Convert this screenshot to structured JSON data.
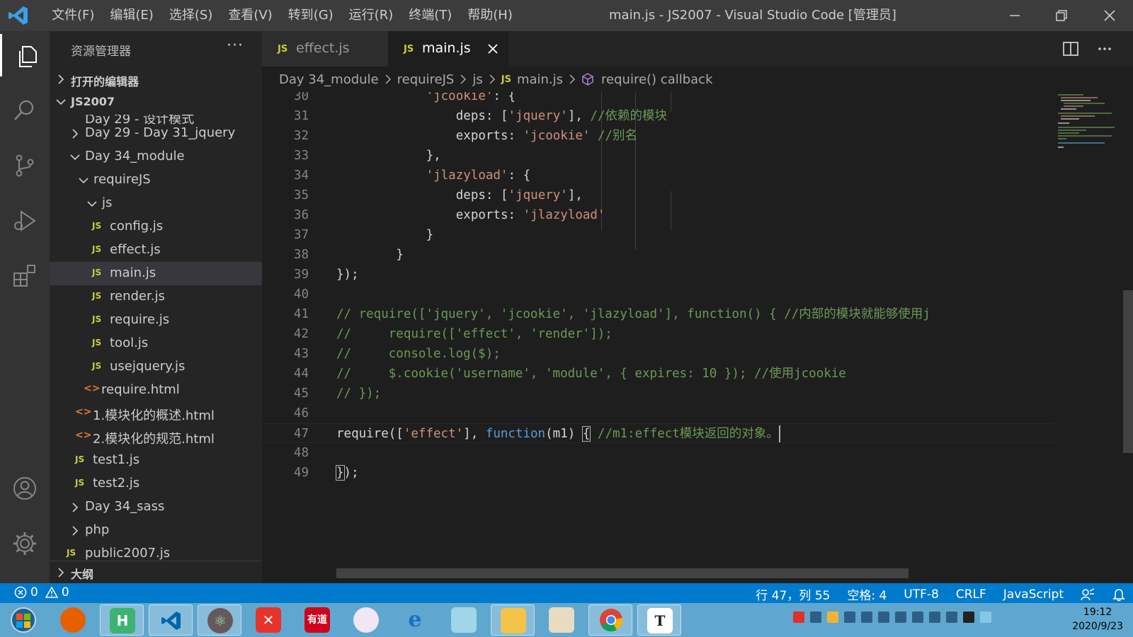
{
  "titlebar": {
    "menus": [
      "文件(F)",
      "编辑(E)",
      "选择(S)",
      "查看(V)",
      "转到(G)",
      "运行(R)",
      "终端(T)",
      "帮助(H)"
    ],
    "title": "main.js - JS2007 - Visual Studio Code [管理员]"
  },
  "sidebar": {
    "title": "资源管理器",
    "more": "···",
    "open_editors": "打开的编辑器",
    "root": "JS2007",
    "cut_item": "Day 29 - 设计模式",
    "items": [
      {
        "label": "Day 29 - Day 31_jquery",
        "kind": "folder",
        "expanded": false
      },
      {
        "label": "Day 34_module",
        "kind": "folder",
        "expanded": true
      },
      {
        "label": "requireJS",
        "kind": "folder",
        "expanded": true
      },
      {
        "label": "js",
        "kind": "folder",
        "expanded": true
      },
      {
        "label": "config.js",
        "kind": "js"
      },
      {
        "label": "effect.js",
        "kind": "js"
      },
      {
        "label": "main.js",
        "kind": "js",
        "selected": true
      },
      {
        "label": "render.js",
        "kind": "js"
      },
      {
        "label": "require.js",
        "kind": "js"
      },
      {
        "label": "tool.js",
        "kind": "js"
      },
      {
        "label": "usejquery.js",
        "kind": "js"
      },
      {
        "label": "require.html",
        "kind": "html"
      },
      {
        "label": "1.模块化的概述.html",
        "kind": "html"
      },
      {
        "label": "2.模块化的规范.html",
        "kind": "html"
      },
      {
        "label": "test1.js",
        "kind": "js"
      },
      {
        "label": "test2.js",
        "kind": "js"
      },
      {
        "label": "Day 34_sass",
        "kind": "folder",
        "expanded": false
      },
      {
        "label": "php",
        "kind": "folder",
        "expanded": false
      },
      {
        "label": "public2007.js",
        "kind": "js"
      }
    ],
    "outline": "大纲"
  },
  "tabs": [
    {
      "label": "effect.js",
      "icon": "JS",
      "active": false
    },
    {
      "label": "main.js",
      "icon": "JS",
      "active": true
    }
  ],
  "breadcrumbs": [
    "Day 34_module",
    "requireJS",
    "js",
    "main.js",
    "require() callback"
  ],
  "editor": {
    "line_numbers": [
      "30",
      "31",
      "32",
      "33",
      "34",
      "35",
      "36",
      "37",
      "38",
      "39",
      "40",
      "41",
      "42",
      "43",
      "44",
      "45",
      "46",
      "47",
      "48",
      "49"
    ],
    "lines": [
      "            'jcookie': {",
      "                deps: ['jquery'], //依赖的模块",
      "                exports: 'jcookie' //别名",
      "            },",
      "            'jlazyload': {",
      "                deps: ['jquery'],",
      "                exports: 'jlazyload'",
      "            }",
      "        }",
      "});",
      "",
      "// require(['jquery', 'jcookie', 'jlazyload'], function() { //内部的模块就能够使用j",
      "//     require(['effect', 'render']);",
      "//     console.log($);",
      "//     $.cookie('username', 'module', { expires: 10 }); //使用jcookie",
      "// });",
      "",
      "require(['effect'], function(m1) { //m1:effect模块返回的对象。",
      "",
      "});"
    ]
  },
  "statusbar": {
    "errors": "0",
    "warnings": "0",
    "position": "行 47，列 55",
    "spaces": "空格: 4",
    "encoding": "UTF-8",
    "eol": "CRLF",
    "language": "JavaScript"
  },
  "taskbar": {
    "apps": [
      "start-orb",
      "firefox",
      "hbuilder",
      "vscode",
      "atom",
      "xmind",
      "youdao",
      "photos",
      "ie",
      "notepad",
      "explorer",
      "paint",
      "chrome",
      "typora"
    ],
    "youdao_label": "有道",
    "typora_label": "T",
    "time": "19:12",
    "date": "2020/9/23"
  },
  "colors": {
    "accent": "#007acc",
    "keyword": "#569cd6",
    "string": "#ce9178",
    "comment": "#6a9955",
    "js_icon": "#cbcb41",
    "html_icon": "#e37933"
  }
}
